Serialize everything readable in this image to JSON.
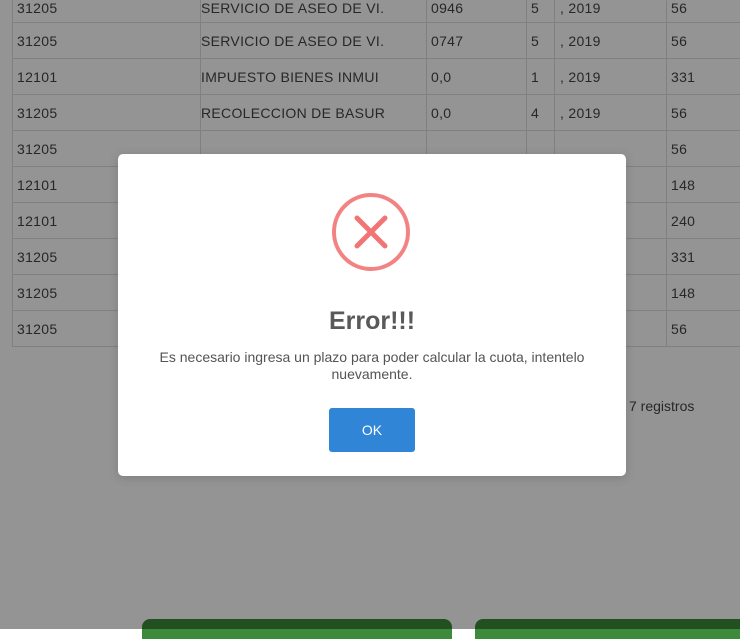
{
  "table": {
    "rows": [
      [
        "31205",
        "SERVICIO DE ASEO DE VI.",
        "0946",
        "5",
        ", 2019",
        "56"
      ],
      [
        "31205",
        "SERVICIO DE ASEO DE VI.",
        "0747",
        "5",
        ", 2019",
        "56"
      ],
      [
        "12101",
        "IMPUESTO BIENES INMUI",
        "0,0",
        "1",
        ", 2019",
        "331"
      ],
      [
        "31205",
        "RECOLECCION DE BASUR",
        "0,0",
        "4",
        ", 2019",
        "56"
      ],
      [
        "31205",
        "",
        "",
        "",
        "",
        "56"
      ],
      [
        "12101",
        "",
        "",
        "",
        "",
        "148"
      ],
      [
        "12101",
        "",
        "",
        "",
        "",
        "240"
      ],
      [
        "31205",
        "",
        "",
        "",
        "",
        "331"
      ],
      [
        "31205",
        "",
        "",
        "",
        "",
        "148"
      ],
      [
        "31205",
        "",
        "",
        "",
        "",
        "56"
      ]
    ]
  },
  "footer": {
    "records_text": "7 registros"
  },
  "modal": {
    "icon": "error-x-icon",
    "icon_color": "#f27474",
    "title": "Error!!!",
    "message": "Es necesario ingresa un plazo para poder calcular la cuota, intentelo nuevamente.",
    "ok_label": "OK",
    "ok_color": "#3085d6"
  }
}
